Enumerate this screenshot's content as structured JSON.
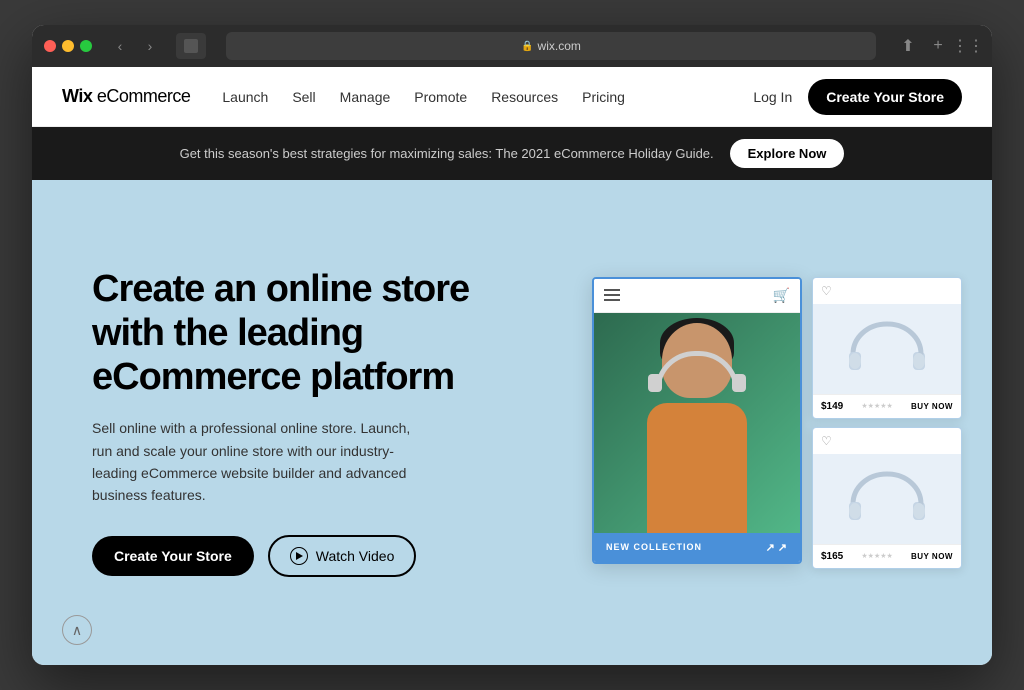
{
  "browser": {
    "url": "wix.com",
    "reload_icon": "↻"
  },
  "nav": {
    "logo_wix": "Wix",
    "logo_ecom": " eCommerce",
    "links": [
      {
        "label": "Launch",
        "id": "launch"
      },
      {
        "label": "Sell",
        "id": "sell"
      },
      {
        "label": "Manage",
        "id": "manage"
      },
      {
        "label": "Promote",
        "id": "promote"
      },
      {
        "label": "Resources",
        "id": "resources"
      },
      {
        "label": "Pricing",
        "id": "pricing"
      }
    ],
    "login_label": "Log In",
    "cta_label": "Create Your Store"
  },
  "promo_banner": {
    "text": "Get this season's best strategies for maximizing sales: The 2021 eCommerce Holiday Guide.",
    "button_label": "Explore Now"
  },
  "hero": {
    "title": "Create an online store with the leading eCommerce platform",
    "description": "Sell online with a professional online store. Launch, run and scale your online store with our industry-leading eCommerce website builder and advanced business features.",
    "cta_primary": "Create Your Store",
    "cta_secondary": "Watch Video"
  },
  "store_mockup": {
    "footer_label": "NEW COLLECTION"
  },
  "product_cards": [
    {
      "price": "$149",
      "buy_label": "BUY NOW"
    },
    {
      "price": "$165",
      "buy_label": "BUY NOW"
    }
  ],
  "icons": {
    "menu": "☰",
    "cart": "🛒",
    "heart": "♡",
    "arrow_up_right": "↗",
    "lock": "🔒",
    "chevron_up": "∧"
  }
}
